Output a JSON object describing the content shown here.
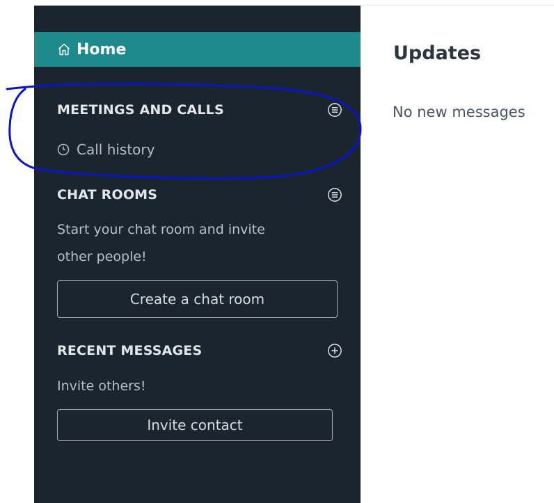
{
  "sidebar": {
    "home_label": "Home",
    "meetings": {
      "title": "MEETINGS AND CALLS",
      "icon": "menu-circle-icon",
      "call_history_label": "Call history",
      "call_history_icon": "clock-icon"
    },
    "chat_rooms": {
      "title": "CHAT ROOMS",
      "icon": "menu-circle-icon",
      "description_line1": "Start your chat room and invite",
      "description_line2": "other people!",
      "button_label": "Create a chat room"
    },
    "recent_messages": {
      "title": "RECENT MESSAGES",
      "icon": "plus-circle-icon",
      "description": "Invite others!",
      "button_label": "Invite contact"
    }
  },
  "main": {
    "title": "Updates",
    "empty_message": "No new messages"
  },
  "colors": {
    "sidebar_bg": "#1b252e",
    "home_active_bg": "#1f8a8c",
    "annotation_stroke": "#0a14c8"
  }
}
